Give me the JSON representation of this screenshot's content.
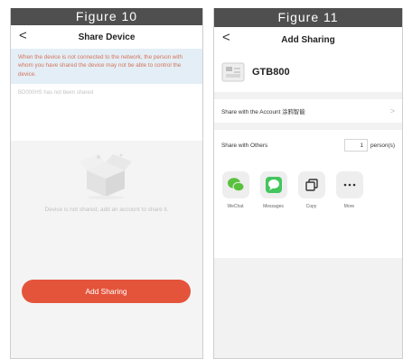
{
  "figure10": {
    "caption": "Figure 10",
    "title": "Share Device",
    "back": "<",
    "warning": "When the device is not connected to the network, the person with whom you have shared the device may not be able to control the device.",
    "not_shared": "BD000HS has not been shared",
    "empty_message": "Device is not shared, add an account to share it.",
    "add_button": "Add Sharing"
  },
  "figure11": {
    "caption": "Figure 11",
    "title": "Add Sharing",
    "back": "<",
    "device_name": "GTB800",
    "share_account": "Share with the Account 涂鸦智能",
    "share_others": "Share with Others",
    "count": "1",
    "unit": "person(s)",
    "chevron": ">",
    "apps": [
      {
        "label": "WeChat",
        "icon": "wechat-icon"
      },
      {
        "label": "Messages",
        "icon": "messages-icon"
      },
      {
        "label": "Copy",
        "icon": "copy-icon"
      },
      {
        "label": "More",
        "icon": "more-icon"
      }
    ]
  },
  "colors": {
    "accent": "#e4543b",
    "warning_text": "#d2745a",
    "warning_bg": "#e4eef6",
    "wechat": "#5ac13d",
    "messages": "#43c55d"
  }
}
